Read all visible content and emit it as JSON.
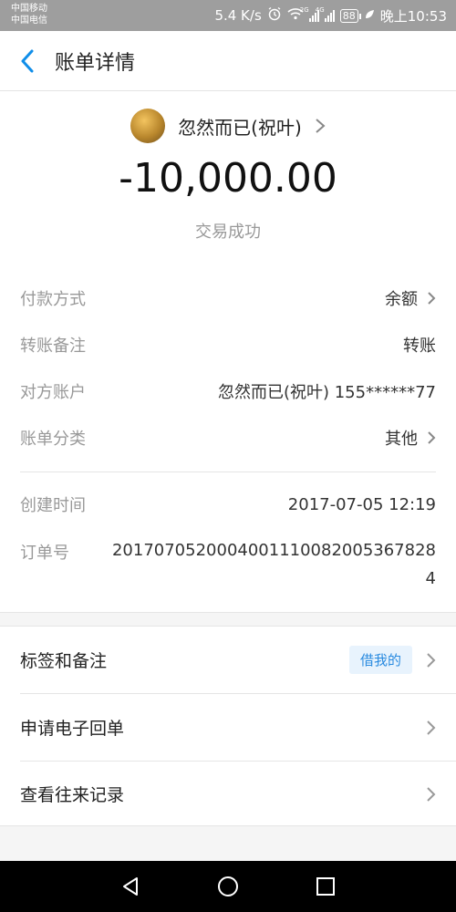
{
  "status_bar": {
    "carrier1": "中国移动",
    "carrier2": "中国电信",
    "speed": "5.4 K/s",
    "net1": "2G",
    "net2": "4G",
    "battery": "88",
    "time": "晚上10:53"
  },
  "header": {
    "title": "账单详情"
  },
  "payee": {
    "name": "忽然而已(祝叶)"
  },
  "transaction": {
    "amount": "-10,000.00",
    "status": "交易成功"
  },
  "details": [
    {
      "label": "付款方式",
      "value": "余额",
      "chevron": true
    },
    {
      "label": "转账备注",
      "value": "转账",
      "chevron": false
    },
    {
      "label": "对方账户",
      "value": "忽然而已(祝叶) 155******77",
      "chevron": false
    },
    {
      "label": "账单分类",
      "value": "其他",
      "chevron": true
    }
  ],
  "meta": {
    "created_label": "创建时间",
    "created_value": "2017-07-05 12:19",
    "order_label": "订单号",
    "order_value": "20170705200040011100820053678284"
  },
  "actions": [
    {
      "label": "标签和备注",
      "tag": "借我的"
    },
    {
      "label": "申请电子回单"
    },
    {
      "label": "查看往来记录"
    }
  ],
  "icons": {
    "back": "chevron-left-icon",
    "alarm": "alarm-icon",
    "wifi": "wifi-icon",
    "signal": "signal-icon",
    "battery": "battery-icon",
    "leaf": "leaf-icon",
    "nav_back": "triangle-back-icon",
    "nav_home": "circle-home-icon",
    "nav_recent": "square-recent-icon"
  },
  "colors": {
    "accent": "#108ee9",
    "tag_bg": "#e8f3fd",
    "tag_text": "#2a8be0"
  }
}
